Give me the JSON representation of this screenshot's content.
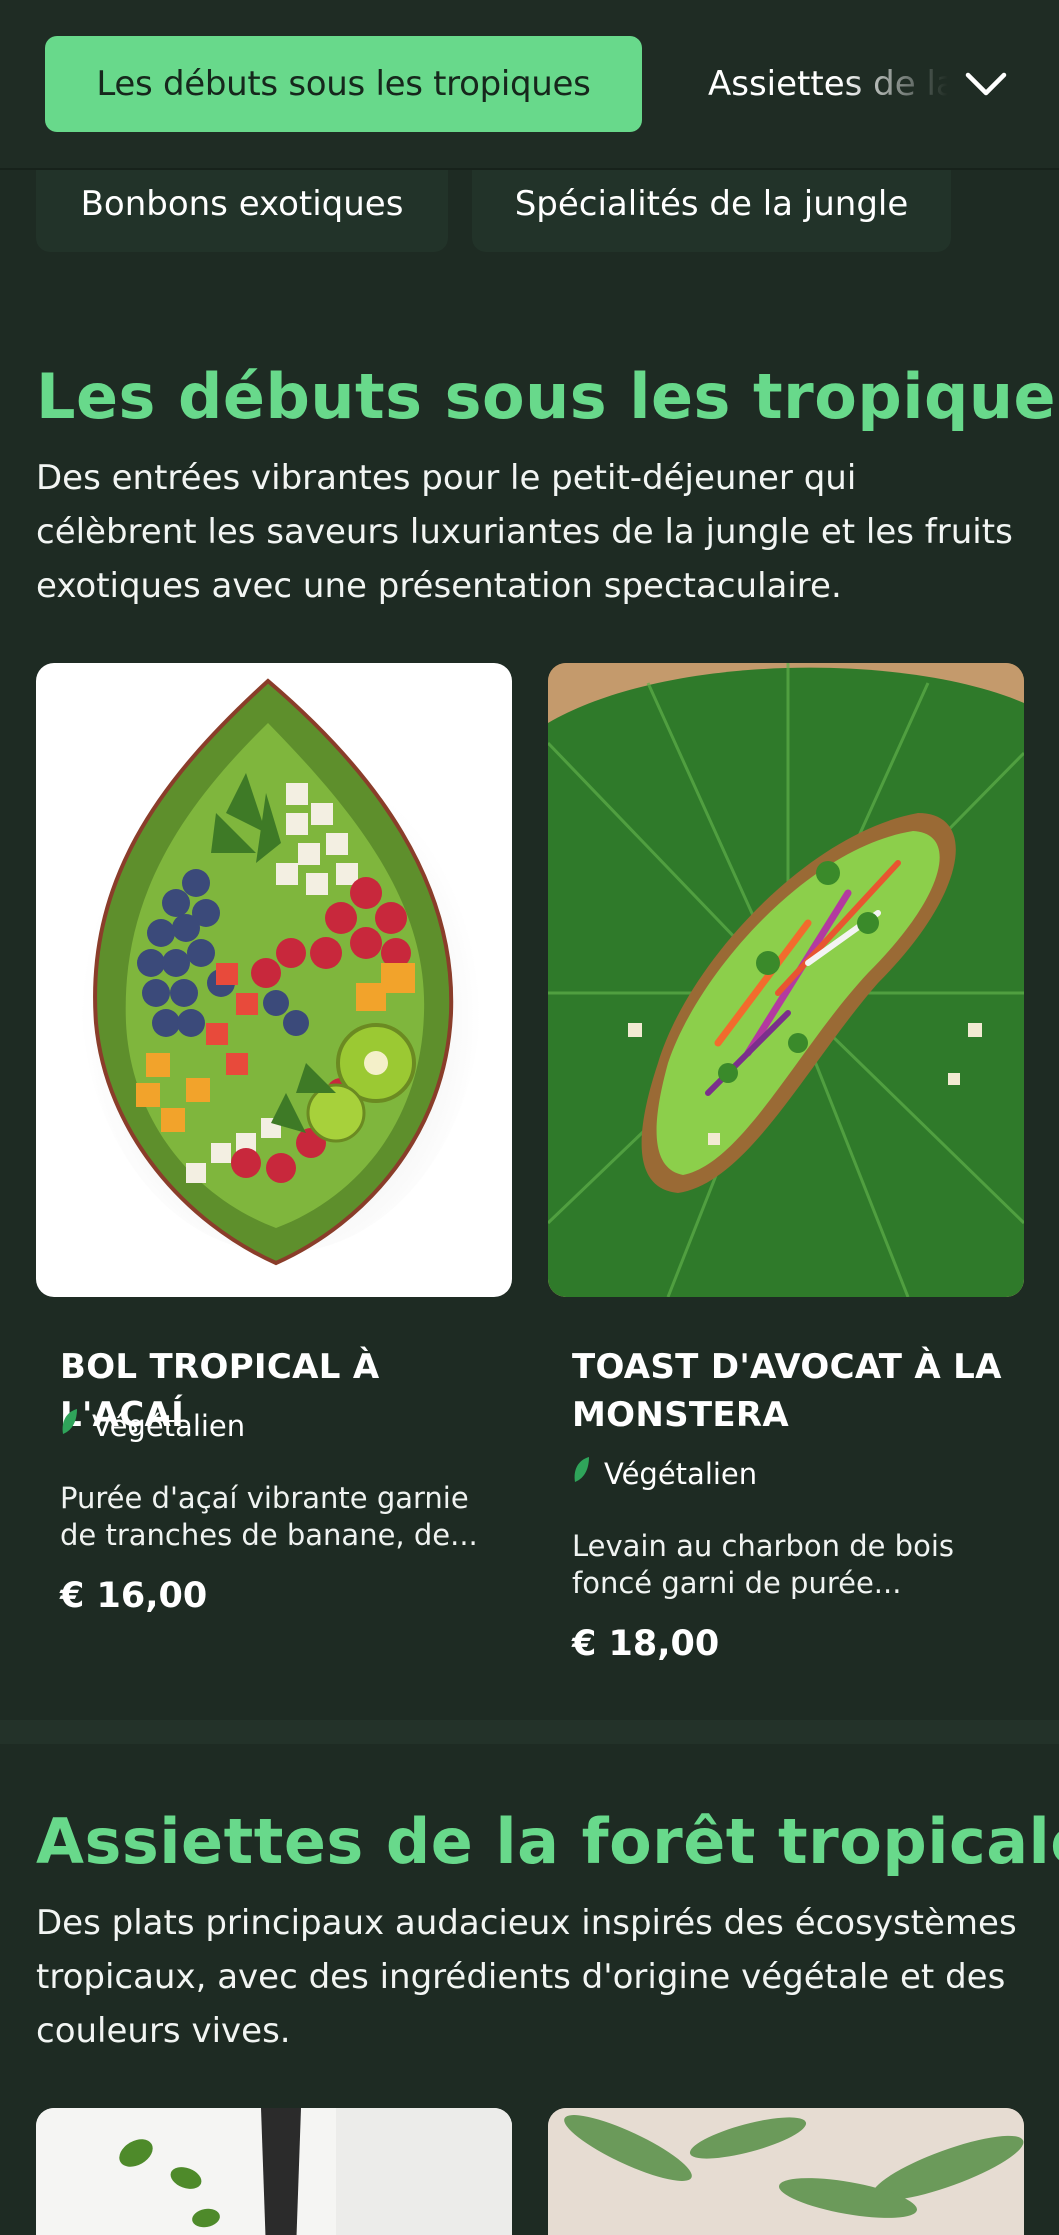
{
  "nav": {
    "active_tab": "Les débuts sous les tropiques",
    "next_tab": "Assiettes de la forêt tropicale",
    "expand_icon": "chevron-down-icon",
    "pills": [
      "Bonbons exotiques",
      "Spécialités de la jungle"
    ]
  },
  "colors": {
    "accent": "#68d98b",
    "background": "#1e2b23"
  },
  "sections": [
    {
      "title": "Les débuts sous les tropiques",
      "description": "Des entrées vibrantes pour le petit-déjeuner qui célèbrent les saveurs luxuriantes de la jungle et les fruits exotiques avec une présentation spectaculaire.",
      "items": [
        {
          "name": "BOL TROPICAL À L'AÇAÍ",
          "diet": "Végétalien",
          "description": "Purée d'açaí vibrante garnie de tranches de banane, de...",
          "price": "€ 16,00"
        },
        {
          "name": "TOAST D'AVOCAT À LA MONSTERA",
          "diet": "Végétalien",
          "description": "Levain au charbon de bois foncé garni de purée...",
          "price": "€ 18,00"
        }
      ]
    },
    {
      "title": "Assiettes de la forêt tropicale",
      "description": "Des plats principaux audacieux inspirés des écosystèmes tropicaux, avec des ingrédients d'origine végétale et des couleurs vives."
    }
  ]
}
